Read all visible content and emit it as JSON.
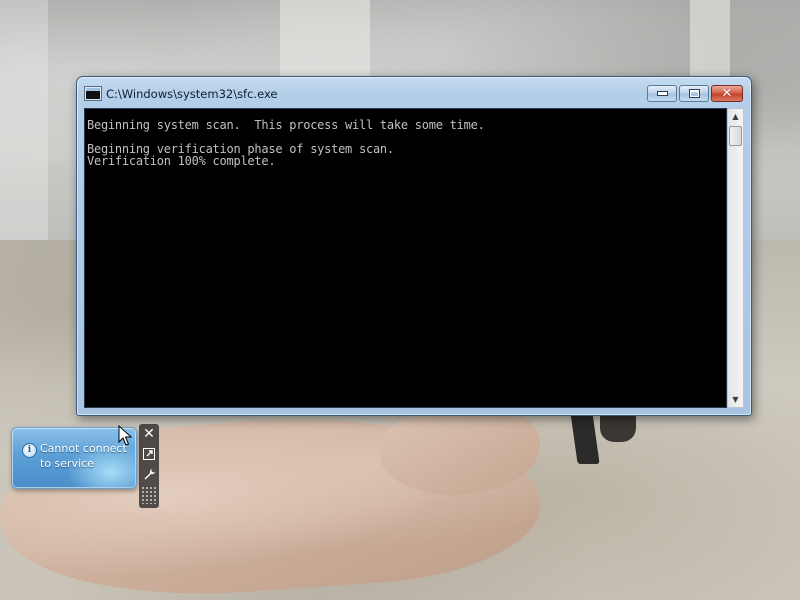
{
  "window": {
    "title": "C:\\Windows\\system32\\sfc.exe",
    "controls": {
      "minimize_icon": "minimize-icon",
      "maximize_icon": "maximize-icon",
      "close_icon": "close-icon"
    }
  },
  "console": {
    "lines": [
      "Beginning system scan.  This process will take some time.",
      "",
      "Beginning verification phase of system scan.",
      "Verification 100% complete."
    ],
    "background": "#000000",
    "text_color": "#c0c0c0"
  },
  "gadget": {
    "message": "Cannot connect to service",
    "tools": [
      "close-icon",
      "resize-icon",
      "options-icon",
      "drag-handle-icon"
    ]
  },
  "theme": {
    "accent": "#a7c4e2",
    "close_button": "#c3402a",
    "gadget": "#5c9fd6"
  }
}
